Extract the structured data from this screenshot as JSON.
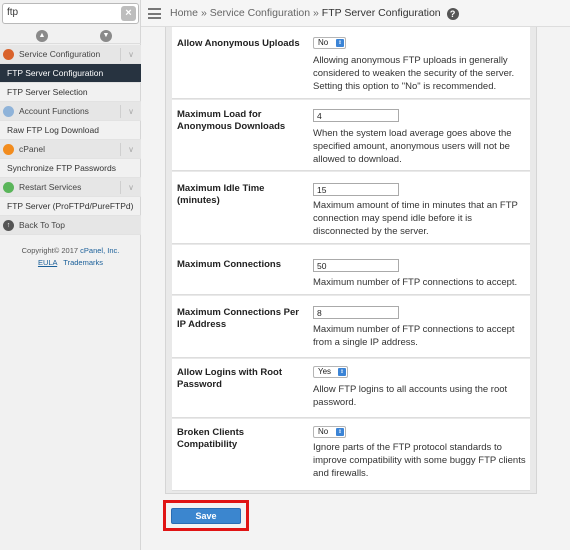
{
  "search": {
    "value": "ftp"
  },
  "sidebar": {
    "items": [
      {
        "label": "Service Configuration"
      },
      {
        "label": "FTP Server Configuration"
      },
      {
        "label": "FTP Server Selection"
      },
      {
        "label": "Account Functions"
      },
      {
        "label": "Raw FTP Log Download"
      },
      {
        "label": "cPanel"
      },
      {
        "label": "Synchronize FTP Passwords"
      },
      {
        "label": "Restart Services"
      },
      {
        "label": "FTP Server (ProFTPd/PureFTPd)"
      },
      {
        "label": "Back To Top"
      }
    ],
    "copyright": "Copyright© 2017",
    "copyright_brand": "cPanel, Inc.",
    "eula": "EULA",
    "trademarks": "Trademarks"
  },
  "breadcrumb": {
    "home": "Home",
    "section": "Service Configuration",
    "current": "FTP Server Configuration",
    "sep": "»"
  },
  "settings": {
    "anon_uploads": {
      "label": "Allow Anonymous Uploads",
      "value": "No",
      "desc": "Allowing anonymous FTP uploads in generally considered to weaken the security of the server. Setting this option to \"No\" is recommended."
    },
    "max_load": {
      "label": "Maximum Load for Anonymous Downloads",
      "value": "4",
      "desc": "When the system load average goes above the specified amount, anonymous users will not be allowed to download."
    },
    "idle_time": {
      "label": "Maximum Idle Time (minutes)",
      "value": "15",
      "desc": "Maximum amount of time in minutes that an FTP connection may spend idle before it is disconnected by the server."
    },
    "max_conn": {
      "label": "Maximum Connections",
      "value": "50",
      "desc": "Maximum number of FTP connections to accept."
    },
    "max_conn_ip": {
      "label": "Maximum Connections Per IP Address",
      "value": "8",
      "desc": "Maximum number of FTP connections to accept from a single IP address."
    },
    "root_login": {
      "label": "Allow Logins with Root Password",
      "value": "Yes",
      "desc": "Allow FTP logins to all accounts using the root password."
    },
    "broken_clients": {
      "label": "Broken Clients Compatibility",
      "value": "No",
      "desc": "Ignore parts of the FTP protocol standards to improve compatibility with some buggy FTP clients and firewalls."
    }
  },
  "actions": {
    "save_label": "Save"
  },
  "colors": {
    "active_nav": "#273340",
    "accent_blue": "#3b86cf",
    "highlight_red": "#e01414"
  }
}
